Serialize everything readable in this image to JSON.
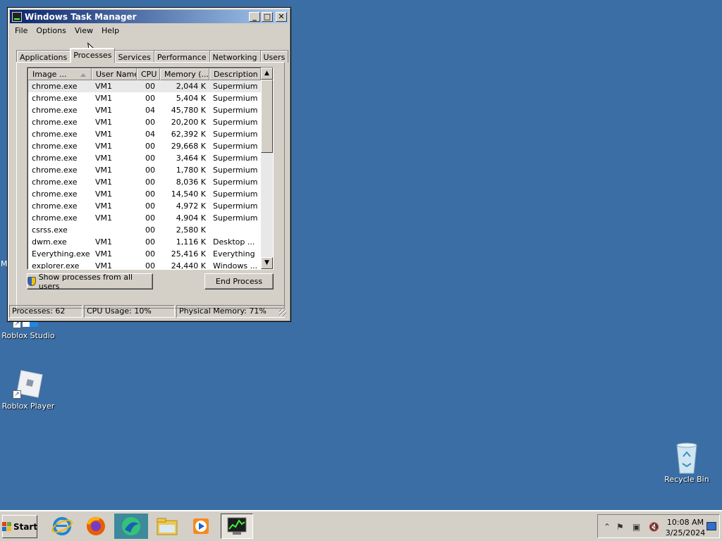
{
  "desktop": {
    "icons": [
      {
        "label": "Roblox Studio"
      },
      {
        "label": "Roblox Player"
      },
      {
        "label": "Recycle Bin"
      }
    ],
    "edge_text": "M"
  },
  "window": {
    "title": "Windows Task Manager",
    "controls": {
      "minimize": "_",
      "maximize": "□",
      "close": "✕"
    },
    "menu": [
      "File",
      "Options",
      "View",
      "Help"
    ],
    "tabs": [
      "Applications",
      "Processes",
      "Services",
      "Performance",
      "Networking",
      "Users"
    ],
    "active_tab": "Processes",
    "columns": [
      "Image ...",
      "User Name",
      "CPU",
      "Memory (...",
      "Description"
    ],
    "rows": [
      {
        "image": "chrome.exe",
        "user": "VM1",
        "cpu": "00",
        "memory": "2,044 K",
        "description": "Supermium"
      },
      {
        "image": "chrome.exe",
        "user": "VM1",
        "cpu": "00",
        "memory": "5,404 K",
        "description": "Supermium"
      },
      {
        "image": "chrome.exe",
        "user": "VM1",
        "cpu": "04",
        "memory": "45,780 K",
        "description": "Supermium"
      },
      {
        "image": "chrome.exe",
        "user": "VM1",
        "cpu": "00",
        "memory": "20,200 K",
        "description": "Supermium"
      },
      {
        "image": "chrome.exe",
        "user": "VM1",
        "cpu": "04",
        "memory": "62,392 K",
        "description": "Supermium"
      },
      {
        "image": "chrome.exe",
        "user": "VM1",
        "cpu": "00",
        "memory": "29,668 K",
        "description": "Supermium"
      },
      {
        "image": "chrome.exe",
        "user": "VM1",
        "cpu": "00",
        "memory": "3,464 K",
        "description": "Supermium"
      },
      {
        "image": "chrome.exe",
        "user": "VM1",
        "cpu": "00",
        "memory": "1,780 K",
        "description": "Supermium"
      },
      {
        "image": "chrome.exe",
        "user": "VM1",
        "cpu": "00",
        "memory": "8,036 K",
        "description": "Supermium"
      },
      {
        "image": "chrome.exe",
        "user": "VM1",
        "cpu": "00",
        "memory": "14,540 K",
        "description": "Supermium"
      },
      {
        "image": "chrome.exe",
        "user": "VM1",
        "cpu": "00",
        "memory": "4,972 K",
        "description": "Supermium"
      },
      {
        "image": "chrome.exe",
        "user": "VM1",
        "cpu": "00",
        "memory": "4,904 K",
        "description": "Supermium"
      },
      {
        "image": "csrss.exe",
        "user": "",
        "cpu": "00",
        "memory": "2,580 K",
        "description": ""
      },
      {
        "image": "dwm.exe",
        "user": "VM1",
        "cpu": "00",
        "memory": "1,116 K",
        "description": "Desktop ..."
      },
      {
        "image": "Everything.exe",
        "user": "VM1",
        "cpu": "00",
        "memory": "25,416 K",
        "description": "Everything"
      },
      {
        "image": "explorer.exe",
        "user": "VM1",
        "cpu": "00",
        "memory": "24,440 K",
        "description": "Windows ..."
      }
    ],
    "show_all_label": "Show processes from all users",
    "end_process_label": "End Process",
    "status": {
      "processes": "Processes: 62",
      "cpu": "CPU Usage: 10%",
      "memory": "Physical Memory: 71%"
    }
  },
  "taskbar": {
    "start_label": "Start",
    "pinned": [
      "internet-explorer-icon",
      "firefox-icon",
      "browser-icon",
      "folder-icon",
      "media-player-icon",
      "task-manager-icon"
    ],
    "clock_time": "10:08 AM",
    "clock_date": "3/25/2024"
  },
  "colors": {
    "desktop": "#3a6ea5",
    "titlebar_start": "#0a246a",
    "titlebar_end": "#a6caf0",
    "chrome": "#d4d0c8"
  }
}
